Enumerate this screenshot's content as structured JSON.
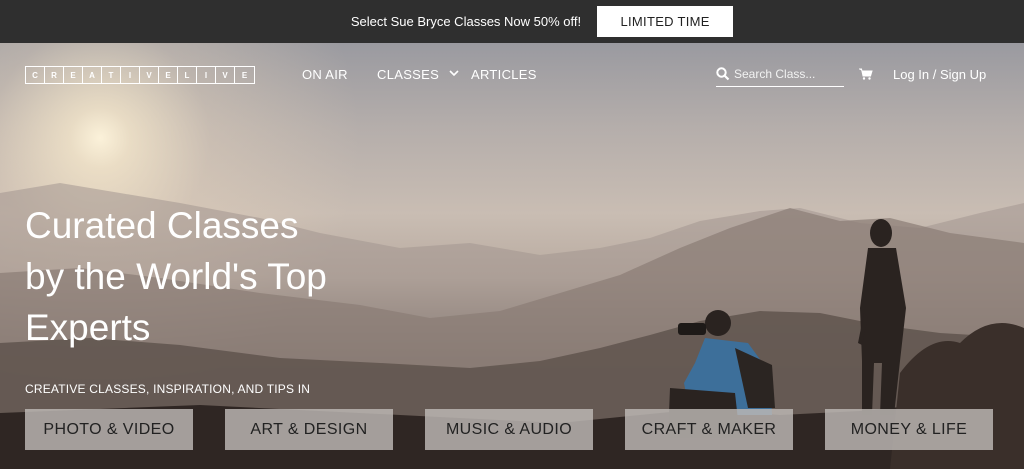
{
  "promo": {
    "text": "Select Sue Bryce Classes Now 50% off!",
    "button_label": "LIMITED TIME"
  },
  "nav": {
    "logo_letters": [
      "C",
      "R",
      "E",
      "A",
      "T",
      "I",
      "V",
      "E",
      "L",
      "I",
      "V",
      "E"
    ],
    "links": {
      "on_air": "ON AIR",
      "classes": "CLASSES",
      "articles": "ARTICLES"
    },
    "search_placeholder": "Search Class...",
    "login": "Log In / Sign Up",
    "icons": [
      "search-icon",
      "cart-icon",
      "chevron-down-icon"
    ]
  },
  "hero": {
    "headline_lines": [
      "Curated Classes",
      "by the World's Top",
      "Experts"
    ],
    "tagline": "CREATIVE CLASSES, INSPIRATION, AND TIPS IN",
    "categories": [
      "PHOTO & VIDEO",
      "ART & DESIGN",
      "MUSIC & AUDIO",
      "CRAFT & MAKER",
      "MONEY & LIFE"
    ]
  },
  "colors": {
    "promo_bg": "#2f2f2f",
    "button_bg": "#ffffff",
    "category_bg": "#bebab6",
    "text_light": "#ffffff"
  }
}
